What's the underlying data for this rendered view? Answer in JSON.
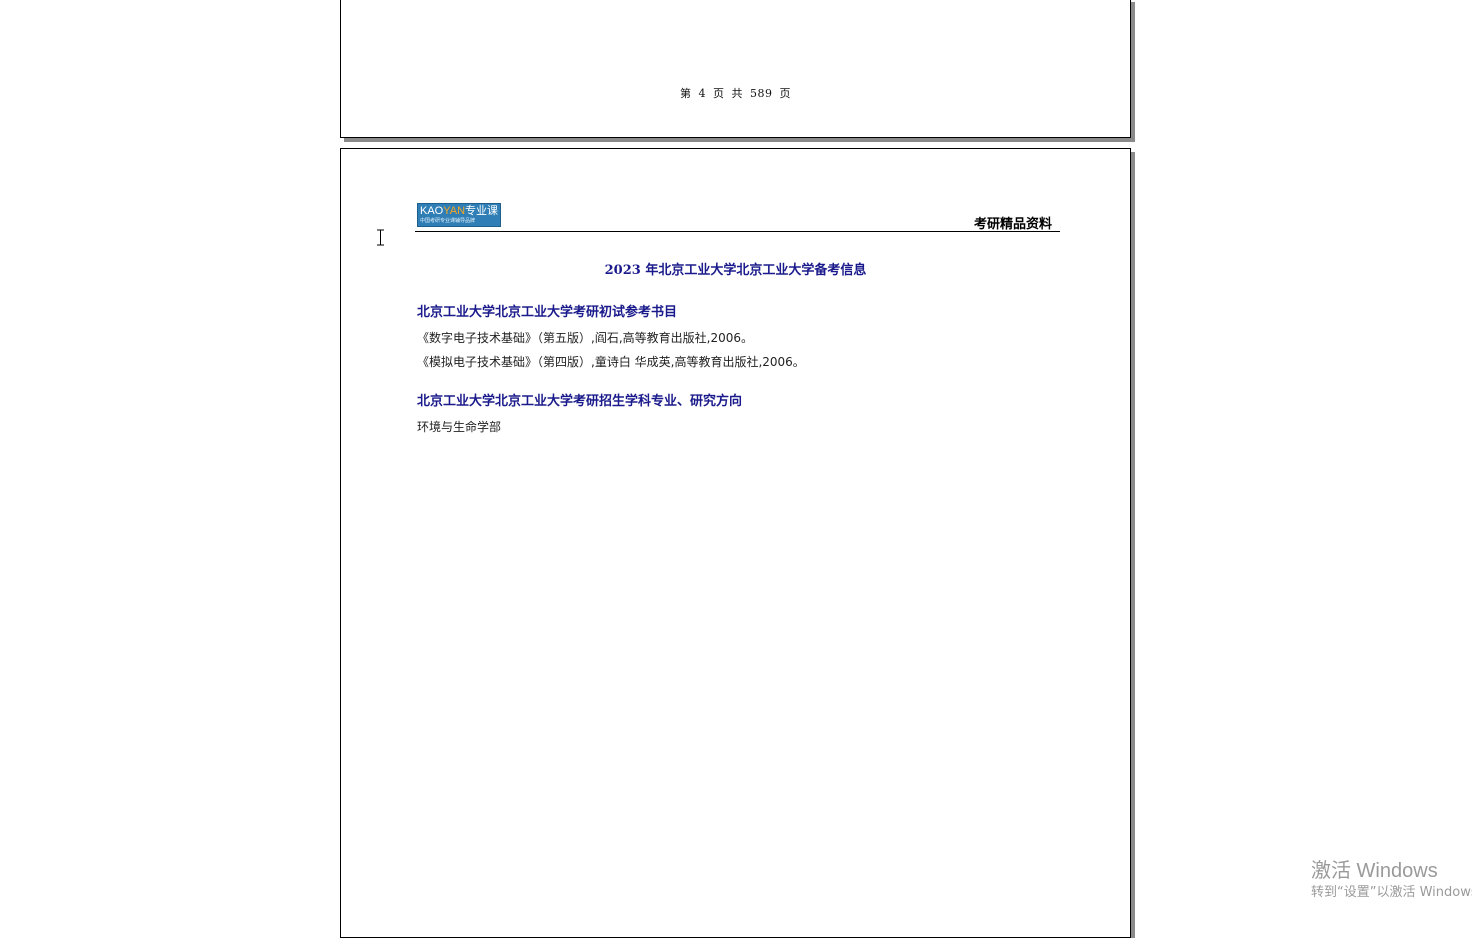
{
  "previous_page": {
    "page_number_text": "第 4 页 共 589 页"
  },
  "current_page": {
    "logo": {
      "brand_prefix": "KAO",
      "brand_accent": "YAN",
      "brand_suffix": "专业课",
      "tagline": "中国考研专业课辅导品牌"
    },
    "header_right": "考研精品资料",
    "title": "2023 年北京工业大学北京工业大学备考信息",
    "sections": [
      {
        "heading": "北京工业大学北京工业大学考研初试参考书目",
        "lines": [
          "《数字电子技术基础》（第五版）,阎石,高等教育出版社,2006。",
          "《模拟电子技术基础》（第四版）,童诗白 华成英,高等教育出版社,2006。"
        ]
      },
      {
        "heading": "北京工业大学北京工业大学考研招生学科专业、研究方向",
        "lines": [
          "环境与生命学部"
        ]
      }
    ]
  },
  "activation_watermark": {
    "title": "激活 Windows",
    "subtitle": "转到“设置”以激活 Windows。"
  },
  "colors": {
    "heading_blue": "#1a1a8c",
    "logo_blue": "#2f7fb6",
    "logo_accent": "#f5a623",
    "page_shadow": "#8a8a8a",
    "watermark_gray": "#9a9a9a"
  },
  "icons": {
    "cursor": "i-beam-text-cursor-icon"
  }
}
